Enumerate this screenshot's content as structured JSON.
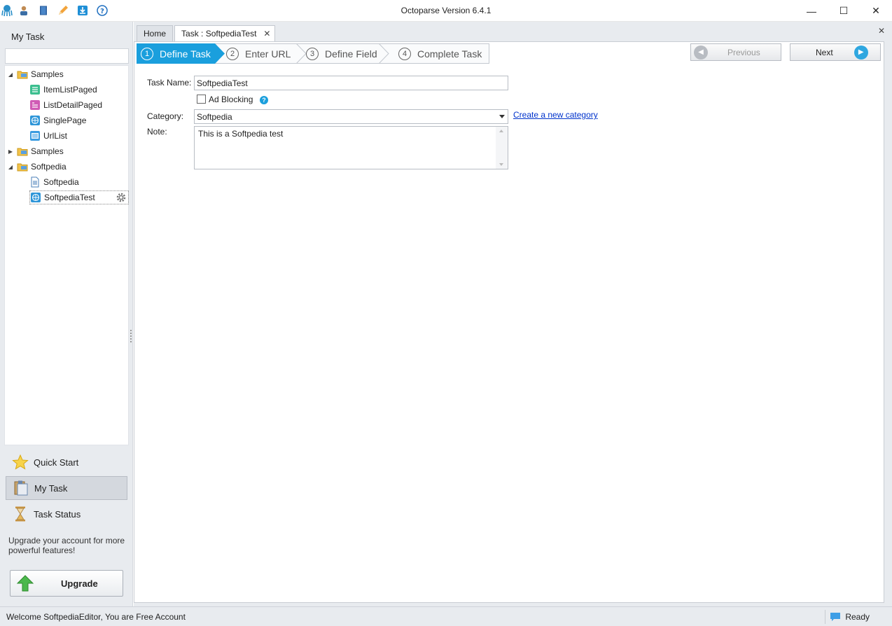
{
  "window": {
    "title": "Octoparse Version 6.4.1",
    "minimize": "—",
    "maximize": "☐",
    "close": "✕"
  },
  "left_panel": {
    "header": "My Task",
    "search_value": "",
    "tree": [
      {
        "label": "Samples",
        "type": "folder",
        "expanded": true,
        "level": 0
      },
      {
        "label": "ItemListPaged",
        "type": "list-task",
        "level": 1
      },
      {
        "label": "ListDetailPaged",
        "type": "detail-task",
        "level": 1
      },
      {
        "label": "SinglePage",
        "type": "web-task",
        "level": 1
      },
      {
        "label": "UrlList",
        "type": "url-task",
        "level": 1
      },
      {
        "label": "Samples",
        "type": "folder",
        "expanded": false,
        "level": 0
      },
      {
        "label": "Softpedia",
        "type": "folder",
        "expanded": true,
        "level": 0
      },
      {
        "label": "Softpedia",
        "type": "doc-task",
        "level": 1
      },
      {
        "label": "SoftpediaTest",
        "type": "web-task",
        "level": 1,
        "selected": true
      }
    ],
    "nav": {
      "quick_start": "Quick Start",
      "my_task": "My Task",
      "task_status": "Task Status"
    },
    "upgrade_message": "Upgrade your account for more powerful features!",
    "upgrade_button": "Upgrade"
  },
  "main": {
    "tabs": [
      {
        "label": "Home"
      },
      {
        "label": "Task : SoftpediaTest",
        "close": "✕"
      }
    ],
    "close_all": "✕",
    "steps": [
      {
        "num": "1",
        "label": "Define Task",
        "active": true
      },
      {
        "num": "2",
        "label": "Enter URL"
      },
      {
        "num": "3",
        "label": "Define Field"
      },
      {
        "num": "4",
        "label": "Complete Task"
      }
    ],
    "previous_button": "Previous",
    "next_button": "Next",
    "form": {
      "task_name_label": "Task Name:",
      "task_name_value": "SoftpediaTest",
      "ad_blocking_label": "Ad Blocking",
      "ad_blocking_checked": false,
      "help_glyph": "?",
      "category_label": "Category:",
      "category_value": "Softpedia",
      "create_category_link": "Create a new category",
      "note_label": "Note:",
      "note_value": "This is a Softpedia test"
    }
  },
  "statusbar": {
    "welcome": "Welcome SoftpediaEditor, You are Free Account",
    "state": "Ready"
  },
  "colors": {
    "accent": "#1a9fdd",
    "link": "#0033cc",
    "panel_bg": "#e8ebef"
  }
}
